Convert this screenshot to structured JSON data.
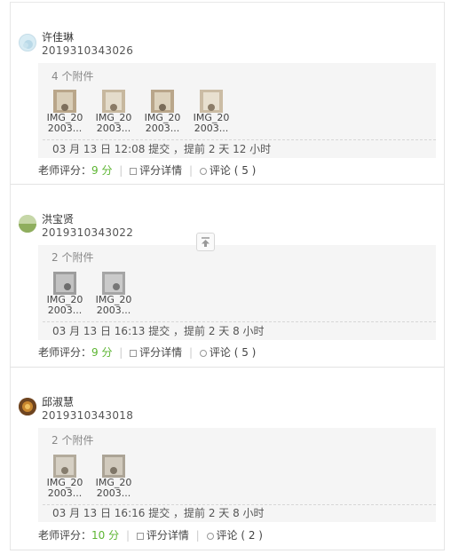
{
  "submissions": [
    {
      "name": "许佳琳",
      "student_id": "2019310343026",
      "attachments_label": "4 个附件",
      "files": [
        {
          "line1": "IMG_20",
          "line2": "2003..."
        },
        {
          "line1": "IMG_20",
          "line2": "2003..."
        },
        {
          "line1": "IMG_20",
          "line2": "2003..."
        },
        {
          "line1": "IMG_20",
          "line2": "2003..."
        }
      ],
      "submit_info": "03 月 13 日 12:08 提交 ，提前 2 天 12 小时",
      "score_label": "老师评分：",
      "score": "9 分",
      "detail_label": "评分详情",
      "comment_label": "评论 ( 5 )"
    },
    {
      "name": "洪宝贤",
      "student_id": "2019310343022",
      "attachments_label": "2 个附件",
      "files": [
        {
          "line1": "IMG_20",
          "line2": "2003..."
        },
        {
          "line1": "IMG_20",
          "line2": "2003..."
        }
      ],
      "submit_info": "03 月 13 日 16:13 提交 ，提前 2 天 8 小时",
      "score_label": "老师评分：",
      "score": "9 分",
      "detail_label": "评分详情",
      "comment_label": "评论 ( 5 )"
    },
    {
      "name": "邱淑慧",
      "student_id": "2019310343018",
      "attachments_label": "2 个附件",
      "files": [
        {
          "line1": "IMG_20",
          "line2": "2003..."
        },
        {
          "line1": "IMG_20",
          "line2": "2003..."
        }
      ],
      "submit_info": "03 月 13 日 16:16 提交 ，提前 2 天 8 小时",
      "score_label": "老师评分：",
      "score": "10 分",
      "detail_label": "评分详情",
      "comment_label": "评论 ( 2 )"
    }
  ],
  "colors": {
    "score_green": "#5cb531",
    "box_bg": "#f5f5f5"
  },
  "icons": {
    "back_to_top": "arrow-up-to-line-icon",
    "detail": "list-icon",
    "comment": "comment-bubble-icon"
  }
}
